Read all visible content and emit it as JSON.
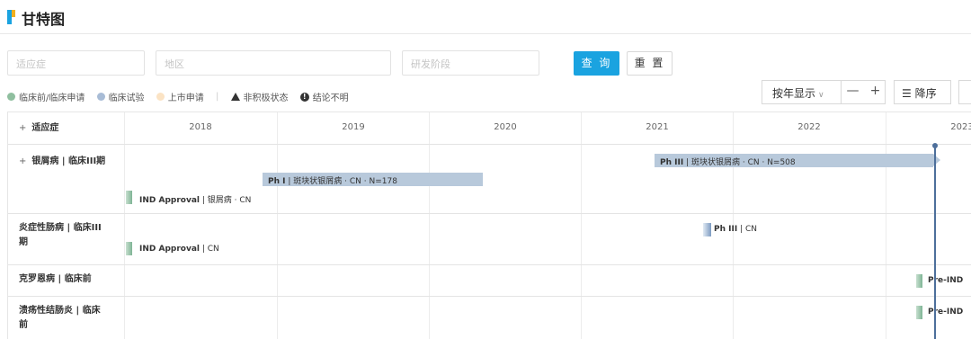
{
  "title": "甘特图",
  "filters": {
    "indication_placeholder": "适应症",
    "region_placeholder": "地区",
    "phase_placeholder": "研发阶段",
    "query_label": "查 询",
    "reset_label": "重 置"
  },
  "legend": {
    "items": [
      {
        "label": "临床前/临床申请",
        "color": "#8fbf9f"
      },
      {
        "label": "临床试验",
        "color": "#a8bcd6"
      },
      {
        "label": "上市申请",
        "color": "#fbe3c4"
      }
    ],
    "inactive_label": "非积极状态",
    "unclear_label": "结论不明"
  },
  "toolbar": {
    "year_view": "按年显示",
    "zoom_out": "—",
    "zoom_in": "+",
    "sort_label": "降序"
  },
  "grid": {
    "header_label": "适应症",
    "years": [
      "2018",
      "2019",
      "2020",
      "2021",
      "2022",
      "2023"
    ]
  },
  "rows": [
    {
      "label": "银屑病 | 临床III期",
      "phase3": {
        "phase": "Ph III",
        "detail": "斑块状银屑病",
        "region": "CN",
        "n": "N=508"
      },
      "phase1": {
        "phase": "Ph I",
        "detail": "斑块状银屑病",
        "region": "CN",
        "n": "N=178"
      },
      "ind": {
        "phase": "IND Approval",
        "detail": "银屑病",
        "region": "CN"
      }
    },
    {
      "label": "炎症性肠病 | 临床III期",
      "phase3": {
        "phase": "Ph III",
        "region": "CN"
      },
      "ind": {
        "phase": "IND Approval",
        "region": "CN"
      }
    },
    {
      "label": "克罗恩病 | 临床前",
      "milestone": "Pre-IND"
    },
    {
      "label": "溃疡性结肠炎 | 临床前",
      "milestone": "Pre-IND"
    }
  ]
}
